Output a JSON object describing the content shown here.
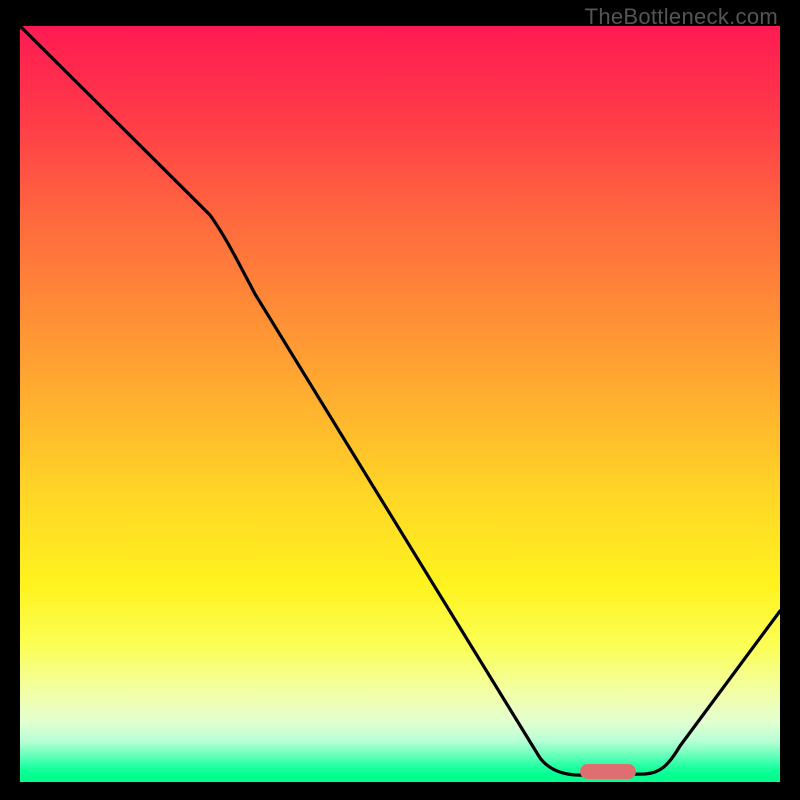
{
  "watermark": "TheBottleneck.com",
  "chart_data": {
    "type": "line",
    "title": "",
    "xlabel": "",
    "ylabel": "",
    "xlim": [
      0,
      100
    ],
    "ylim": [
      0,
      100
    ],
    "series": [
      {
        "name": "bottleneck-curve",
        "x": [
          0,
          25,
          70,
          77,
          82,
          100
        ],
        "y": [
          100,
          75,
          4,
          1,
          1,
          22
        ]
      }
    ],
    "annotations": [
      {
        "name": "optimal-marker",
        "x": 77,
        "y": 1.2,
        "width": 6
      }
    ],
    "background_gradient": {
      "orientation": "vertical",
      "stops": [
        {
          "pos": 0.0,
          "color": "#ff1a52"
        },
        {
          "pos": 0.26,
          "color": "#ff6a3e"
        },
        {
          "pos": 0.62,
          "color": "#ffd626"
        },
        {
          "pos": 0.88,
          "color": "#f3ffa5"
        },
        {
          "pos": 1.0,
          "color": "#00ff8d"
        }
      ]
    }
  }
}
